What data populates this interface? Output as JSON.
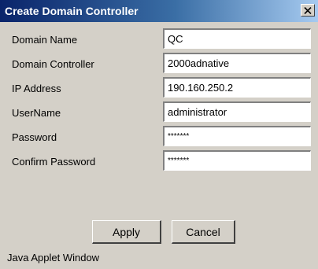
{
  "window": {
    "title": "Create Domain Controller",
    "close_icon": "close-icon"
  },
  "form": {
    "fields": [
      {
        "label": "Domain Name",
        "value": "QC"
      },
      {
        "label": "Domain Controller",
        "value": "2000adnative"
      },
      {
        "label": "IP Address",
        "value": "190.160.250.2"
      },
      {
        "label": "UserName",
        "value": "administrator"
      },
      {
        "label": "Password",
        "value": "*******"
      },
      {
        "label": "Confirm Password",
        "value": "*******"
      }
    ]
  },
  "buttons": {
    "apply_label": "Apply",
    "cancel_label": "Cancel"
  },
  "footer": {
    "status_text": "Java Applet Window"
  },
  "colors": {
    "title_bar_start": "#0a246a",
    "title_bar_end": "#a6caf0",
    "dialog_background": "#d4d0c8"
  }
}
